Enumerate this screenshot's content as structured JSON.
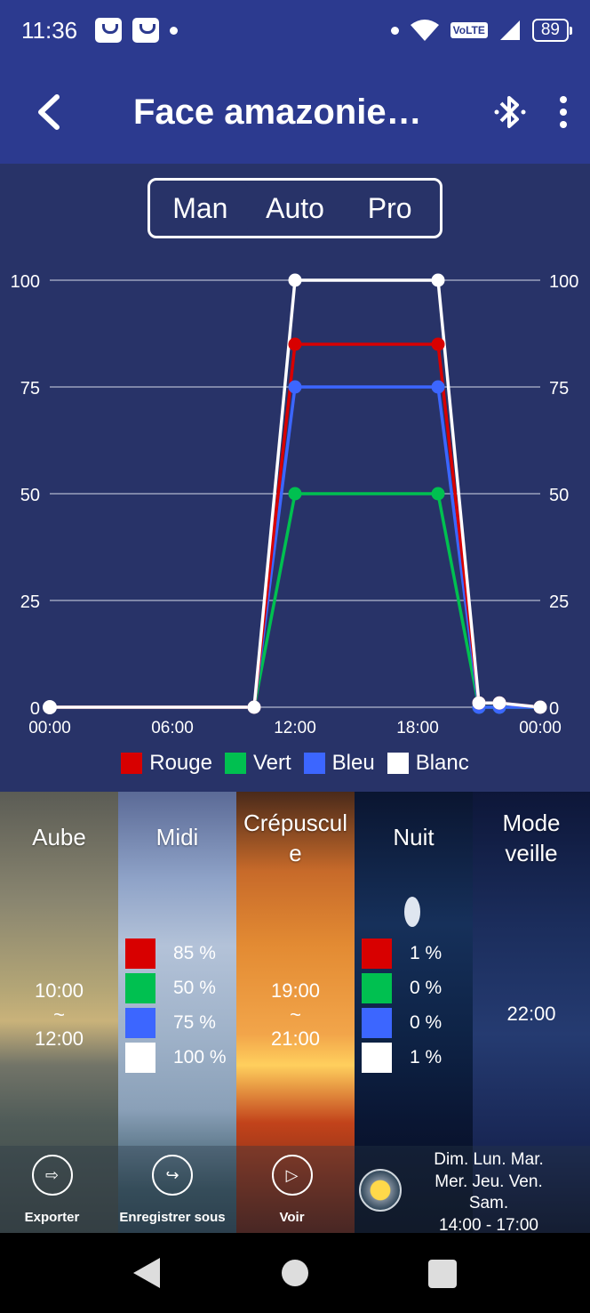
{
  "status": {
    "time": "11:36",
    "network": "VoLTE",
    "signal": "4G",
    "battery": "89"
  },
  "appbar": {
    "title": "Face amazonie…",
    "icons": [
      "back-arrow-icon",
      "bluetooth-icon",
      "more-vert-icon"
    ]
  },
  "modes": {
    "items": [
      "Man",
      "Auto",
      "Pro"
    ],
    "selected": "Auto"
  },
  "chart_data": {
    "type": "line",
    "x_ticks": [
      "00:00",
      "06:00",
      "12:00",
      "18:00",
      "00:00"
    ],
    "y_ticks": [
      "0",
      "25",
      "50",
      "75",
      "100"
    ],
    "ylim": [
      0,
      100
    ],
    "x": [
      0,
      10,
      12,
      19,
      21,
      22,
      24
    ],
    "x_unit": "hour of day",
    "series": [
      {
        "name": "Rouge",
        "color": "#d80000",
        "values": [
          0,
          0,
          85,
          85,
          1,
          1,
          0
        ]
      },
      {
        "name": "Vert",
        "color": "#00c050",
        "values": [
          0,
          0,
          50,
          50,
          0,
          0,
          0
        ]
      },
      {
        "name": "Bleu",
        "color": "#3c66ff",
        "values": [
          0,
          0,
          75,
          75,
          0,
          0,
          0
        ]
      },
      {
        "name": "Blanc",
        "color": "#ffffff",
        "values": [
          0,
          0,
          100,
          100,
          1,
          1,
          0
        ]
      }
    ],
    "grid": true,
    "legend": "bottom"
  },
  "legend": [
    {
      "label": "Rouge",
      "color": "#d80000"
    },
    {
      "label": "Vert",
      "color": "#00c050"
    },
    {
      "label": "Bleu",
      "color": "#3c66ff"
    },
    {
      "label": "Blanc",
      "color": "#ffffff"
    }
  ],
  "panels": {
    "aube": {
      "title": "Aube",
      "start": "10:00",
      "sep": "~",
      "end": "12:00"
    },
    "midi": {
      "title": "Midi",
      "values": [
        "85 %",
        "50 %",
        "75 %",
        "100 %"
      ]
    },
    "crepuscule": {
      "title": "Crépuscul\ne",
      "start": "19:00",
      "sep": "~",
      "end": "21:00"
    },
    "nuit": {
      "title": "Nuit",
      "values": [
        "1 %",
        "0 %",
        "0 %",
        "1 %"
      ]
    },
    "veille": {
      "title": "Mode\nveille",
      "time": "22:00"
    }
  },
  "actions": {
    "export": "Exporter",
    "save_as": "Enregistrer sous",
    "view": "Voir"
  },
  "schedule": {
    "days": "Dim. Lun. Mar. Mer. Jeu. Ven. Sam.",
    "hours": "14:00 - 17:00"
  }
}
